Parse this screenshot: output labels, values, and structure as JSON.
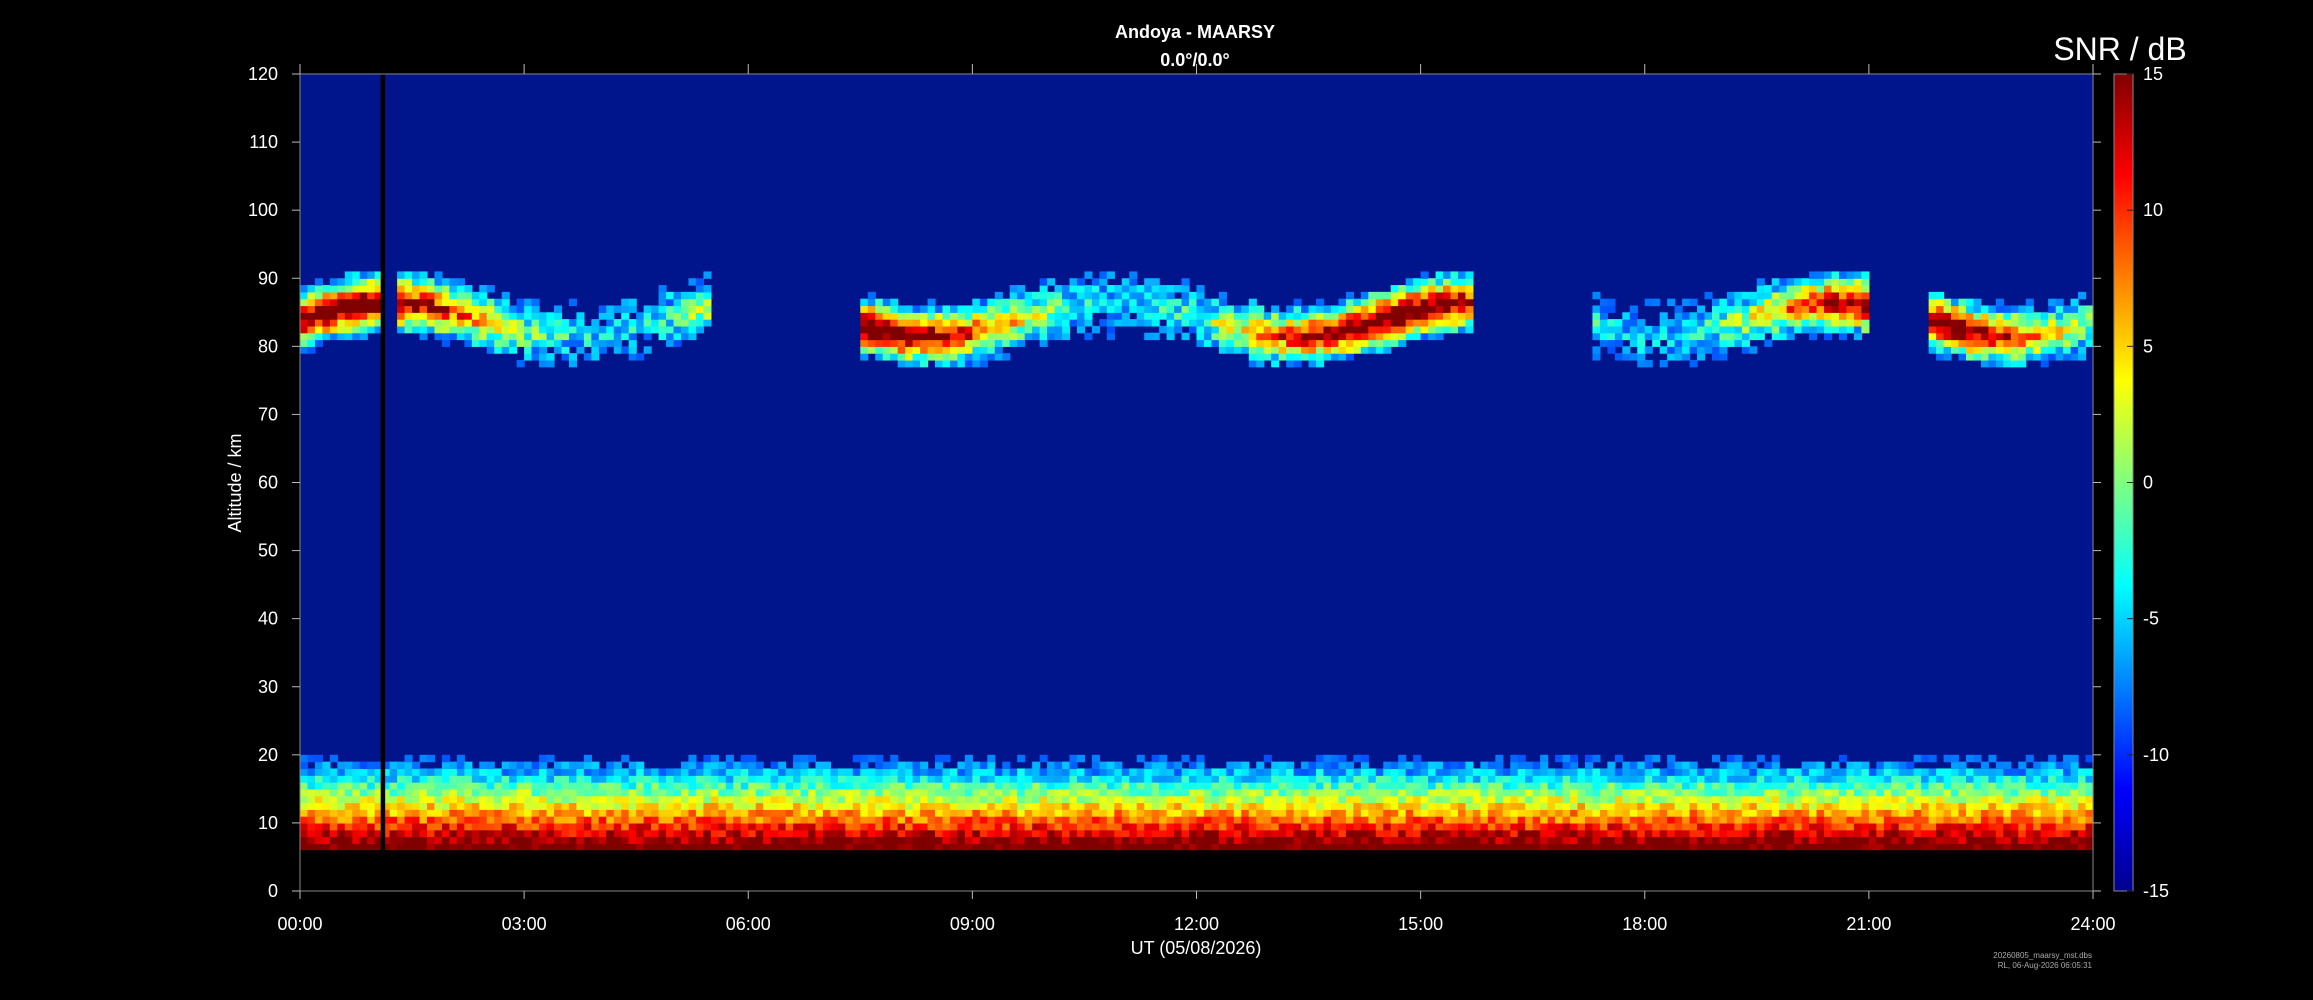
{
  "chart_data": {
    "type": "heatmap",
    "title": "Andoya - MAARSY",
    "subtitle": "0.0°/0.0°",
    "xlabel": "UT (05/08/2026)",
    "ylabel": "Altitude / km",
    "x_ticks": [
      "00:00",
      "03:00",
      "06:00",
      "09:00",
      "12:00",
      "15:00",
      "18:00",
      "21:00",
      "24:00"
    ],
    "x_range_hours": [
      0,
      24
    ],
    "y_ticks": [
      0,
      10,
      20,
      30,
      40,
      50,
      60,
      70,
      80,
      90,
      100,
      110,
      120
    ],
    "ylim": [
      0,
      120
    ],
    "colorbar": {
      "label": "SNR / dB",
      "range": [
        -15,
        15
      ],
      "ticks": [
        15,
        10,
        5,
        0,
        -5,
        -10,
        -15
      ],
      "colormap": "jet"
    },
    "data_gap_hours": [
      1.08,
      1.14
    ],
    "valid_altitude_km": [
      6,
      120
    ],
    "background_snr_db": -11,
    "echo_layers": [
      {
        "name": "troposphere/lower stratosphere",
        "alt_range_km": [
          6,
          20
        ],
        "peak_snr_db": 15
      },
      {
        "name": "polar mesosphere summer echoes",
        "alt_range_km": [
          80,
          90
        ],
        "peak_snr_db": 15,
        "segments_hours": [
          [
            0,
            1.1
          ],
          [
            1.3,
            5.5
          ],
          [
            7.5,
            15.7
          ],
          [
            17.3,
            21.0
          ],
          [
            21.8,
            24
          ]
        ]
      }
    ],
    "grid": false
  },
  "footer": {
    "file": "20260805_maarsy_mst.dbs",
    "processed": "RL, 06-Aug-2026 06:05:31"
  }
}
